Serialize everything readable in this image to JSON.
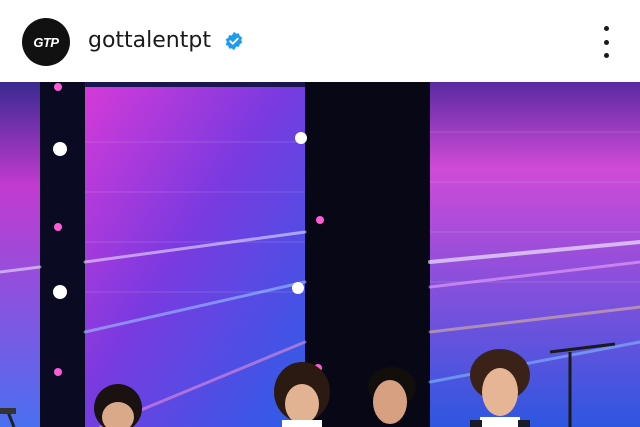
{
  "post_header": {
    "avatar_text": "GTP",
    "username": "gottalentpt",
    "verified": true,
    "verified_icon": "verified-badge-icon",
    "more_icon": "more-options-icon",
    "colors": {
      "verified": "#1d9bf0",
      "avatar_bg": "#111111"
    }
  },
  "post_media": {
    "type": "photo",
    "description_icon": "stage-photo"
  }
}
